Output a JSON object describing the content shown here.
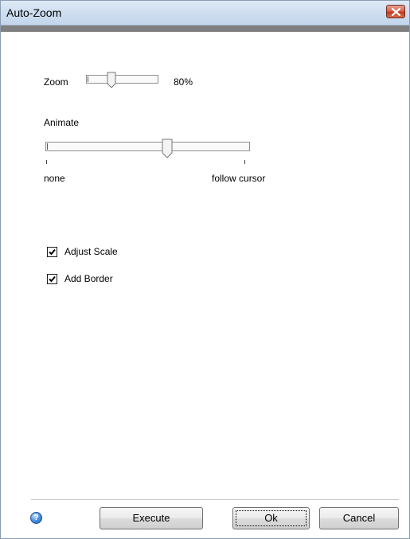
{
  "window": {
    "title": "Auto-Zoom"
  },
  "zoom": {
    "label": "Zoom",
    "value_text": "80%",
    "value": 80
  },
  "animate": {
    "label": "Animate",
    "min_label": "none",
    "max_label": "follow cursor"
  },
  "options": [
    {
      "label": "Adjust Scale",
      "checked": true
    },
    {
      "label": "Add Border",
      "checked": true
    }
  ],
  "buttons": {
    "execute": "Execute",
    "ok": "Ok",
    "cancel": "Cancel"
  },
  "help": {
    "glyph": "?"
  },
  "colors": {
    "close_button": "#c23a20",
    "accent_bar": "#7f7f7f"
  }
}
